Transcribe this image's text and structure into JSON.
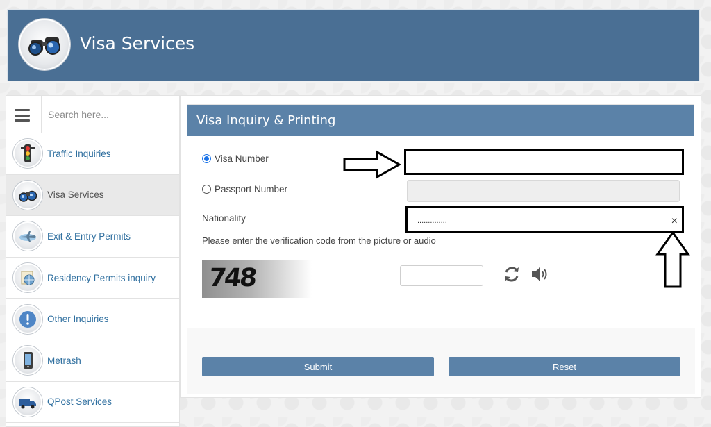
{
  "header": {
    "title": "Visa Services"
  },
  "sidebar": {
    "search_placeholder": "Search here...",
    "items": [
      {
        "label": "Traffic Inquiries",
        "icon": "traffic-light-icon"
      },
      {
        "label": "Visa Services",
        "icon": "binoculars-icon",
        "active": true
      },
      {
        "label": "Exit & Entry Permits",
        "icon": "airplane-icon"
      },
      {
        "label": "Residency Permits inquiry",
        "icon": "document-globe-icon"
      },
      {
        "label": "Other Inquiries",
        "icon": "exclamation-icon"
      },
      {
        "label": "Metrash",
        "icon": "phone-icon"
      },
      {
        "label": "QPost Services",
        "icon": "delivery-truck-icon"
      }
    ]
  },
  "form": {
    "title": "Visa Inquiry & Printing",
    "visa_number_label": "Visa Number",
    "passport_number_label": "Passport Number",
    "selected_option": "Visa Number",
    "nationality_label": "Nationality",
    "nationality_value": "..............",
    "clear_symbol": "×",
    "verification_label": "Please enter the verification code from the picture or audio",
    "captcha_code": "748",
    "submit_label": "Submit",
    "reset_label": "Reset"
  },
  "colors": {
    "header_bg": "#4a6f94",
    "panel_header_bg": "#5b82a8",
    "button_bg": "#5b82a8",
    "link_text": "#2f6f9f"
  }
}
